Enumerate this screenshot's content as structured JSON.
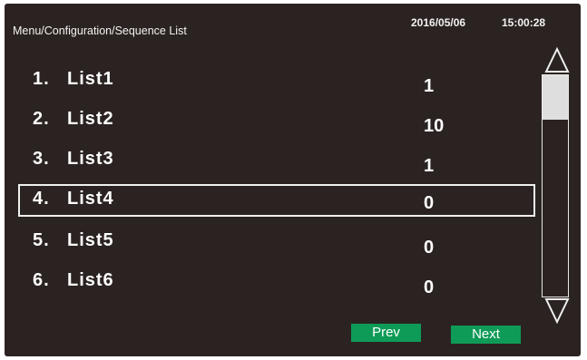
{
  "header": {
    "breadcrumb": "Menu/Configuration/Sequence List",
    "date": "2016/05/06",
    "time": "15:00:28"
  },
  "list": {
    "items": [
      {
        "num": "1.",
        "name": "List1",
        "value": "1"
      },
      {
        "num": "2.",
        "name": "List2",
        "value": "10"
      },
      {
        "num": "3.",
        "name": "List3",
        "value": "1"
      },
      {
        "num": "4.",
        "name": "List4",
        "value": "0"
      },
      {
        "num": "5.",
        "name": "List5",
        "value": "0"
      },
      {
        "num": "6.",
        "name": "List6",
        "value": "0"
      }
    ],
    "selected_index": 4
  },
  "footer": {
    "prev_label": "Prev",
    "next_label": "Next"
  },
  "colors": {
    "background": "#2b2321",
    "button": "#0e9b57",
    "text": "#ffffff"
  },
  "icons": {
    "scroll_up": "triangle-up-icon",
    "scroll_down": "triangle-down-icon"
  }
}
